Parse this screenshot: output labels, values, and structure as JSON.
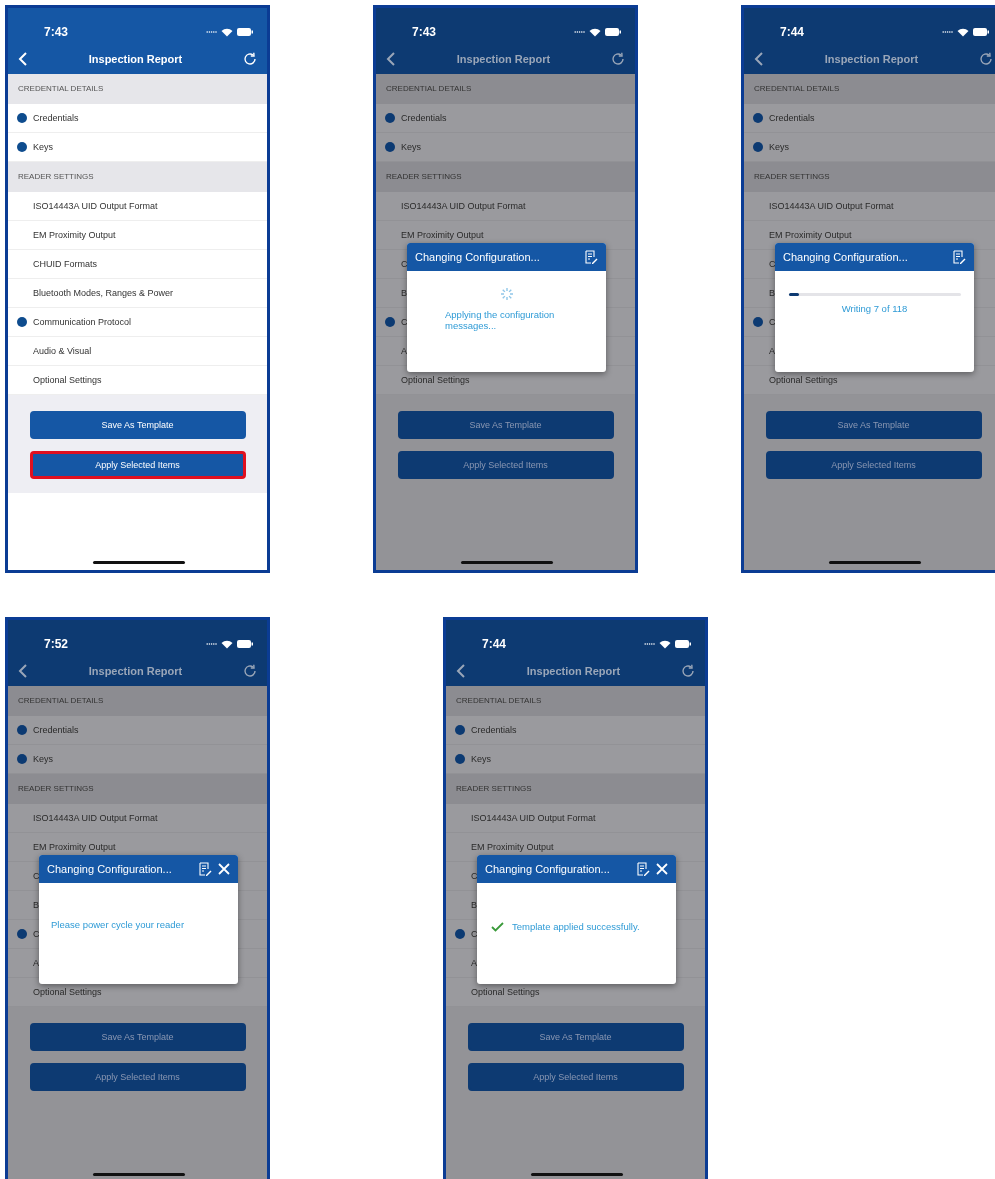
{
  "phones": [
    {
      "time": "7:43",
      "title": "Inspection Report",
      "dimmed": false,
      "sections": [
        {
          "heading": "CREDENTIAL DETAILS",
          "items": [
            {
              "label": "Credentials",
              "marked": true
            },
            {
              "label": "Keys",
              "marked": true
            }
          ]
        },
        {
          "heading": "READER SETTINGS",
          "items": [
            {
              "label": "ISO14443A UID Output Format",
              "marked": false
            },
            {
              "label": "EM Proximity Output",
              "marked": false
            },
            {
              "label": "CHUID Formats",
              "marked": false
            },
            {
              "label": "Bluetooth Modes, Ranges & Power",
              "marked": false
            },
            {
              "label": "Communication Protocol",
              "marked": true
            },
            {
              "label": "Audio & Visual",
              "marked": false
            },
            {
              "label": "Optional Settings",
              "marked": false
            }
          ]
        }
      ],
      "buttons": [
        {
          "label": "Save As Template",
          "highlighted": false
        },
        {
          "label": "Apply Selected Items",
          "highlighted": true
        }
      ]
    },
    {
      "time": "7:43",
      "title": "Inspection Report",
      "dimmed": true,
      "sections": [
        {
          "heading": "CREDENTIAL DETAILS",
          "items": [
            {
              "label": "Credentials",
              "marked": true
            },
            {
              "label": "Keys",
              "marked": true
            }
          ]
        },
        {
          "heading": "READER SETTINGS",
          "items": [
            {
              "label": "ISO14443A UID Output Format",
              "marked": false
            },
            {
              "label": "EM Proximity Output",
              "marked": false
            },
            {
              "label": "C",
              "marked": false
            },
            {
              "label": "B",
              "marked": false
            },
            {
              "label": "C",
              "marked": true
            },
            {
              "label": "A",
              "marked": false
            },
            {
              "label": "Optional Settings",
              "marked": false
            }
          ]
        }
      ],
      "buttons": [
        {
          "label": "Save As Template",
          "highlighted": false
        },
        {
          "label": "Apply Selected Items",
          "highlighted": false
        }
      ],
      "dialog": {
        "title": "Changing Configuration...",
        "closable": false,
        "kind": "spinner",
        "message": "Applying the configuration messages..."
      }
    },
    {
      "time": "7:44",
      "title": "Inspection Report",
      "dimmed": true,
      "sections": [
        {
          "heading": "CREDENTIAL DETAILS",
          "items": [
            {
              "label": "Credentials",
              "marked": true
            },
            {
              "label": "Keys",
              "marked": true
            }
          ]
        },
        {
          "heading": "READER SETTINGS",
          "items": [
            {
              "label": "ISO14443A UID Output Format",
              "marked": false
            },
            {
              "label": "EM Proximity Output",
              "marked": false
            },
            {
              "label": "C",
              "marked": false
            },
            {
              "label": "B",
              "marked": false
            },
            {
              "label": "C",
              "marked": true
            },
            {
              "label": "A",
              "marked": false
            },
            {
              "label": "Optional Settings",
              "marked": false
            }
          ]
        }
      ],
      "buttons": [
        {
          "label": "Save As Template",
          "highlighted": false
        },
        {
          "label": "Apply Selected Items",
          "highlighted": false
        }
      ],
      "dialog": {
        "title": "Changing Configuration...",
        "closable": false,
        "kind": "progress",
        "level": 0.06,
        "message": "Writing 7 of 118"
      }
    },
    {
      "time": "7:52",
      "title": "Inspection Report",
      "dimmed": true,
      "sections": [
        {
          "heading": "CREDENTIAL DETAILS",
          "items": [
            {
              "label": "Credentials",
              "marked": true
            },
            {
              "label": "Keys",
              "marked": true
            }
          ]
        },
        {
          "heading": "READER SETTINGS",
          "items": [
            {
              "label": "ISO14443A UID Output Format",
              "marked": false
            },
            {
              "label": "EM Proximity Output",
              "marked": false
            },
            {
              "label": "C",
              "marked": false
            },
            {
              "label": "B",
              "marked": false
            },
            {
              "label": "C",
              "marked": true
            },
            {
              "label": "A",
              "marked": false
            },
            {
              "label": "Optional Settings",
              "marked": false
            }
          ]
        }
      ],
      "buttons": [
        {
          "label": "Save As Template",
          "highlighted": false
        },
        {
          "label": "Apply Selected Items",
          "highlighted": false
        }
      ],
      "dialog": {
        "title": "Changing Configuration...",
        "closable": true,
        "kind": "text",
        "message": "Please power cycle your reader"
      }
    },
    {
      "time": "7:44",
      "title": "Inspection Report",
      "dimmed": true,
      "sections": [
        {
          "heading": "CREDENTIAL DETAILS",
          "items": [
            {
              "label": "Credentials",
              "marked": true
            },
            {
              "label": "Keys",
              "marked": true
            }
          ]
        },
        {
          "heading": "READER SETTINGS",
          "items": [
            {
              "label": "ISO14443A UID Output Format",
              "marked": false
            },
            {
              "label": "EM Proximity Output",
              "marked": false
            },
            {
              "label": "C",
              "marked": false
            },
            {
              "label": "B",
              "marked": false
            },
            {
              "label": "C",
              "marked": true
            },
            {
              "label": "A",
              "marked": false
            },
            {
              "label": "Optional Settings",
              "marked": false
            }
          ]
        }
      ],
      "buttons": [
        {
          "label": "Save As Template",
          "highlighted": false
        },
        {
          "label": "Apply Selected Items",
          "highlighted": false
        }
      ],
      "dialog": {
        "title": "Changing Configuration...",
        "closable": true,
        "kind": "success",
        "message": "Template applied successfully."
      }
    }
  ]
}
